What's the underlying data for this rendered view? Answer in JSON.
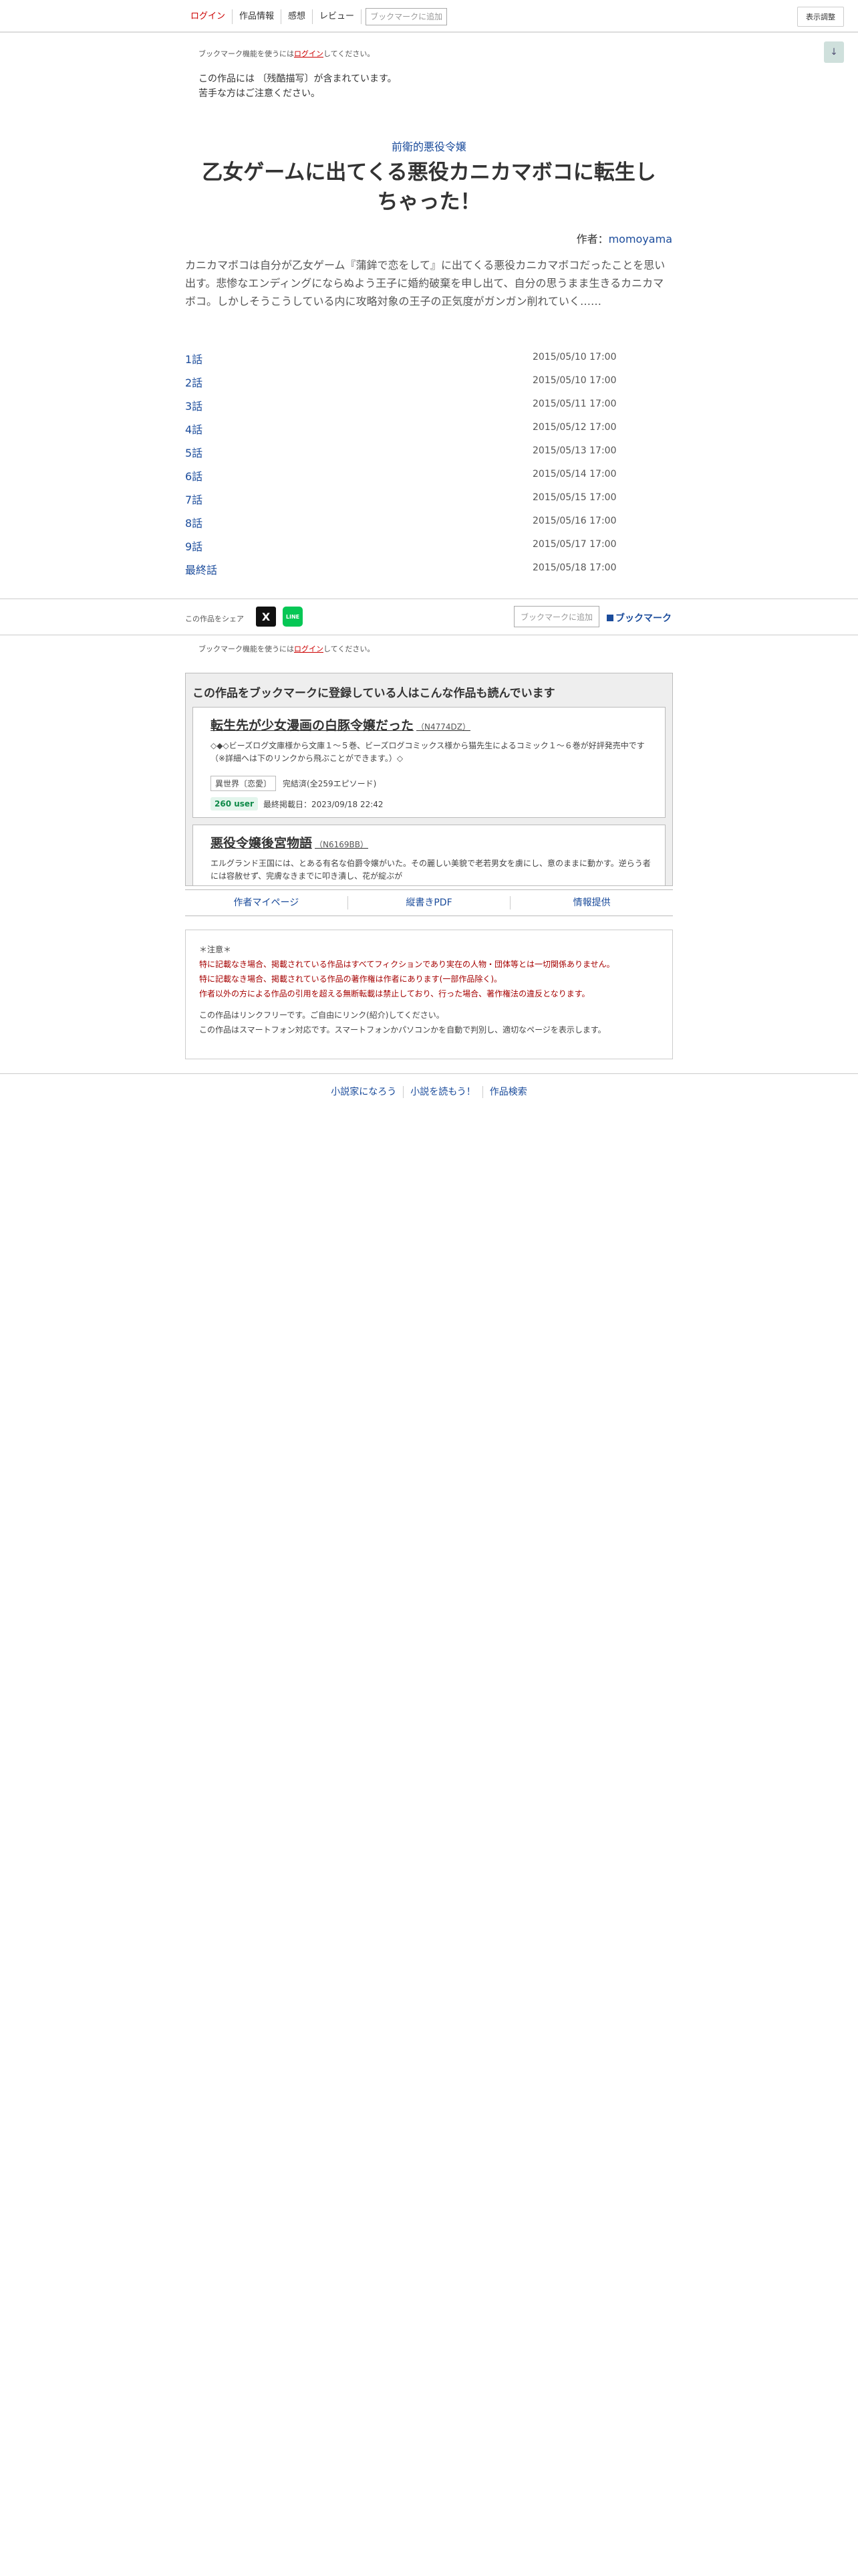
{
  "nav": {
    "login": "ログイン",
    "work_info": "作品情報",
    "impressions": "感想",
    "review": "レビュー",
    "bookmark_add": "ブックマークに追加",
    "display_adjust": "表示調整"
  },
  "scroll_down_glyph": "↓",
  "login_note": {
    "prefix": "ブックマーク機能を使うには",
    "link": "ログイン",
    "suffix": "してください。"
  },
  "content_warning": {
    "line1": "この作品には 〔残酷描写〕が含まれています。",
    "line2": "苦手な方はご注意ください。"
  },
  "series_title": "前衛的悪役令嬢",
  "novel_title": "乙女ゲームに出てくる悪役カニカマボコに転生しちゃった！",
  "author": {
    "label": "作者：",
    "name": "momoyama"
  },
  "synopsis": "カニカマボコは自分が乙女ゲーム『蒲鉾で恋をして』に出てくる悪役カニカマボコだったことを思い出す。悲惨なエンディングにならぬよう王子に婚約破棄を申し出て、自分の思うまま生きるカニカマボコ。しかしそうこうしている内に攻略対象の王子の正気度がガンガン削れていく……",
  "episodes": [
    {
      "title": "1話",
      "date": "2015/05/10 17:00"
    },
    {
      "title": "2話",
      "date": "2015/05/10 17:00"
    },
    {
      "title": "3話",
      "date": "2015/05/11 17:00"
    },
    {
      "title": "4話",
      "date": "2015/05/12 17:00"
    },
    {
      "title": "5話",
      "date": "2015/05/13 17:00"
    },
    {
      "title": "6話",
      "date": "2015/05/14 17:00"
    },
    {
      "title": "7話",
      "date": "2015/05/15 17:00"
    },
    {
      "title": "8話",
      "date": "2015/05/16 17:00"
    },
    {
      "title": "9話",
      "date": "2015/05/17 17:00"
    },
    {
      "title": "最終話",
      "date": "2015/05/18 17:00"
    }
  ],
  "share": {
    "label": "この作品をシェア",
    "x_glyph": "X",
    "line_glyph": "LINE",
    "bookmark_add": "ブックマークに追加",
    "bookmark": "ブックマーク"
  },
  "recommend": {
    "heading": "この作品をブックマークに登録している人はこんな作品も読んでいます",
    "items": [
      {
        "title": "転生先が少女漫画の白豚令嬢だった",
        "code": "（N4774DZ）",
        "desc": "◇◆◇ビーズログ文庫様から文庫１～５巻、ビーズログコミックス様から猫先生によるコミック１～６巻が好評発売中です（※詳細へは下のリンクから飛ぶことができます。）◇",
        "genre": "異世界〔恋愛〕",
        "type": "完結済(全259エピソード)",
        "users": "260 user",
        "updated": "最終掲載日：2023/09/18 22:42"
      },
      {
        "title": "悪役令嬢後宮物語",
        "code": "（N6169BB）",
        "desc": "エルグランド王国には、とある有名な伯爵令嬢がいた。その麗しい美貌で老若男女を虜にし、意のままに動かす。逆らう者には容赦せず、完膚なきまでに叩き潰し、花が綻ぶが"
      }
    ]
  },
  "links": {
    "author_page": "作者マイページ",
    "pdf": "縦書きPDF",
    "report": "情報提供"
  },
  "notice": {
    "head": "＊注意＊",
    "red1": "特に記載なき場合、掲載されている作品はすべてフィクションであり実在の人物・団体等とは一切関係ありません。",
    "red2": "特に記載なき場合、掲載されている作品の著作権は作者にあります(一部作品除く)。",
    "red3": "作者以外の方による作品の引用を超える無断転載は禁止しており、行った場合、著作権法の違反となります。",
    "grey1": "この作品はリンクフリーです。ご自由にリンク(紹介)してください。",
    "grey2": "この作品はスマートフォン対応です。スマートフォンかパソコンかを自動で判別し、適切なページを表示します。"
  },
  "footer": {
    "naro": "小説家になろう",
    "yomou": "小説を読もう！",
    "search": "作品検索"
  }
}
